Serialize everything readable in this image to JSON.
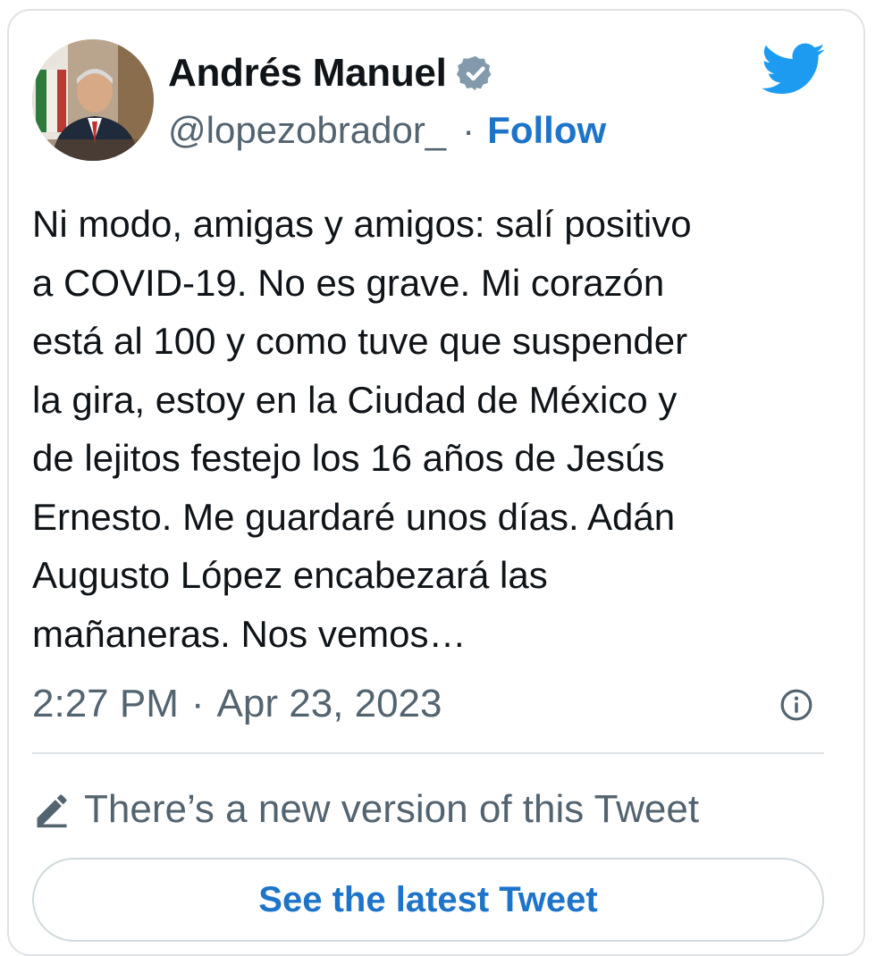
{
  "tweet": {
    "author": {
      "display_name": "Andrés Manuel",
      "handle": "@lopezobrador_",
      "verified_icon": "verified-badge-icon",
      "avatar": "avatar"
    },
    "separator": "·",
    "follow_label": "Follow",
    "brand_icon": "twitter-bird-icon",
    "text": "Ni modo, amigas y amigos: salí positivo\na COVID-19. No es grave. Mi corazón\nestá al 100 y como tuve que suspender\nla gira, estoy en la Ciudad de México y\nde lejitos festejo los 16 años de Jesús\nErnesto. Me guardaré unos días. Adán\nAugusto López encabezará las\nmañaneras. Nos vemos…",
    "time": "2:27 PM",
    "date": "Apr 23, 2023",
    "info_icon": "info-icon"
  },
  "edit_notice": {
    "icon": "pencil-icon",
    "text": "There’s a new version of this Tweet",
    "button_label": "See the latest Tweet"
  },
  "colors": {
    "link": "#1d74c9",
    "twitter_blue": "#1d9bf0",
    "muted_text": "#536471",
    "border": "#dfe3e6",
    "verified_badge": "#829aab"
  }
}
